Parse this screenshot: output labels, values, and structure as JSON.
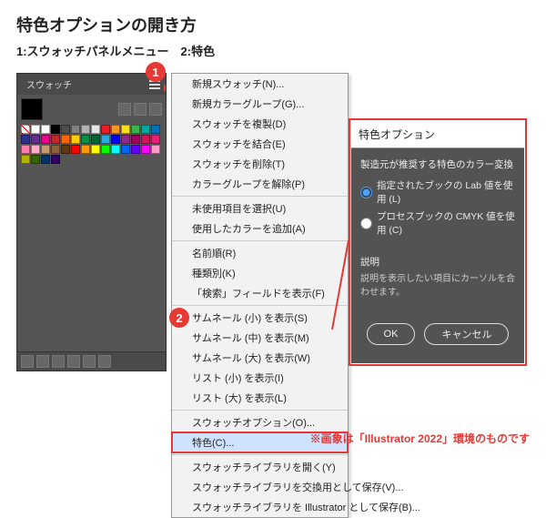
{
  "title": "特色オプションの開き方",
  "subtitle": "1:スウォッチパネルメニュー　2:特色",
  "panel": {
    "tab": "スウォッチ",
    "swatch_colors": [
      "none",
      "reg",
      "#ffffff",
      "#000000",
      "#4d4d4d",
      "#808080",
      "#b3b3b3",
      "#e6e6e6",
      "#ed1c24",
      "#f7931e",
      "#ffde17",
      "#39b54a",
      "#00a99d",
      "#0072bc",
      "#2e3192",
      "#662d91",
      "#ec008c",
      "#c1272d",
      "#ff6600",
      "#ffcc00",
      "#009245",
      "#006837",
      "#29abe2",
      "#0000ff",
      "#93278f",
      "#9e005d",
      "#d4145a",
      "#ed1e79",
      "#ff7bac",
      "#ffaec9",
      "#c69c6d",
      "#8c6239",
      "#603913",
      "#ff0000",
      "#ff9900",
      "#ffff00",
      "#00ff00",
      "#00ffff",
      "#0066ff",
      "#6600ff",
      "#ff00ff",
      "#ff99cc",
      "#b3b300",
      "#336600",
      "#003366",
      "#330066"
    ]
  },
  "menu": {
    "items": [
      {
        "label": "新規スウォッチ(N)..."
      },
      {
        "label": "新規カラーグループ(G)..."
      },
      {
        "label": "スウォッチを複製(D)"
      },
      {
        "label": "スウォッチを結合(E)"
      },
      {
        "label": "スウォッチを削除(T)"
      },
      {
        "label": "カラーグループを解除(P)"
      },
      {
        "sep": true
      },
      {
        "label": "未使用項目を選択(U)"
      },
      {
        "label": "使用したカラーを追加(A)"
      },
      {
        "sep": true
      },
      {
        "label": "名前順(R)"
      },
      {
        "label": "種類別(K)"
      },
      {
        "label": "「検索」フィールドを表示(F)"
      },
      {
        "sep": true
      },
      {
        "label": "サムネール (小) を表示(S)",
        "checked": true
      },
      {
        "label": "サムネール (中) を表示(M)"
      },
      {
        "label": "サムネール (大) を表示(W)"
      },
      {
        "label": "リスト (小) を表示(I)"
      },
      {
        "label": "リスト (大) を表示(L)"
      },
      {
        "sep": true
      },
      {
        "label": "スウォッチオプション(O)..."
      },
      {
        "label": "特色(C)...",
        "highlight": true
      },
      {
        "sep": true
      },
      {
        "label": "スウォッチライブラリを開く(Y)"
      },
      {
        "label": "スウォッチライブラリを交換用として保存(V)..."
      },
      {
        "label": "スウォッチライブラリを Illustrator として保存(B)..."
      }
    ]
  },
  "dialog": {
    "title": "特色オプション",
    "section": "製造元が推奨する特色のカラー変換",
    "radio1": "指定されたブックの Lab 値を使用 (L)",
    "radio2": "プロセスブックの CMYK 値を使用 (C)",
    "desc_head": "説明",
    "desc_body": "説明を表示したい項目にカーソルを合わせます。",
    "ok": "OK",
    "cancel": "キャンセル"
  },
  "caption": "※画象は「Illustrator 2022」環境のものです",
  "badges": {
    "b1": "1",
    "b2": "2"
  }
}
